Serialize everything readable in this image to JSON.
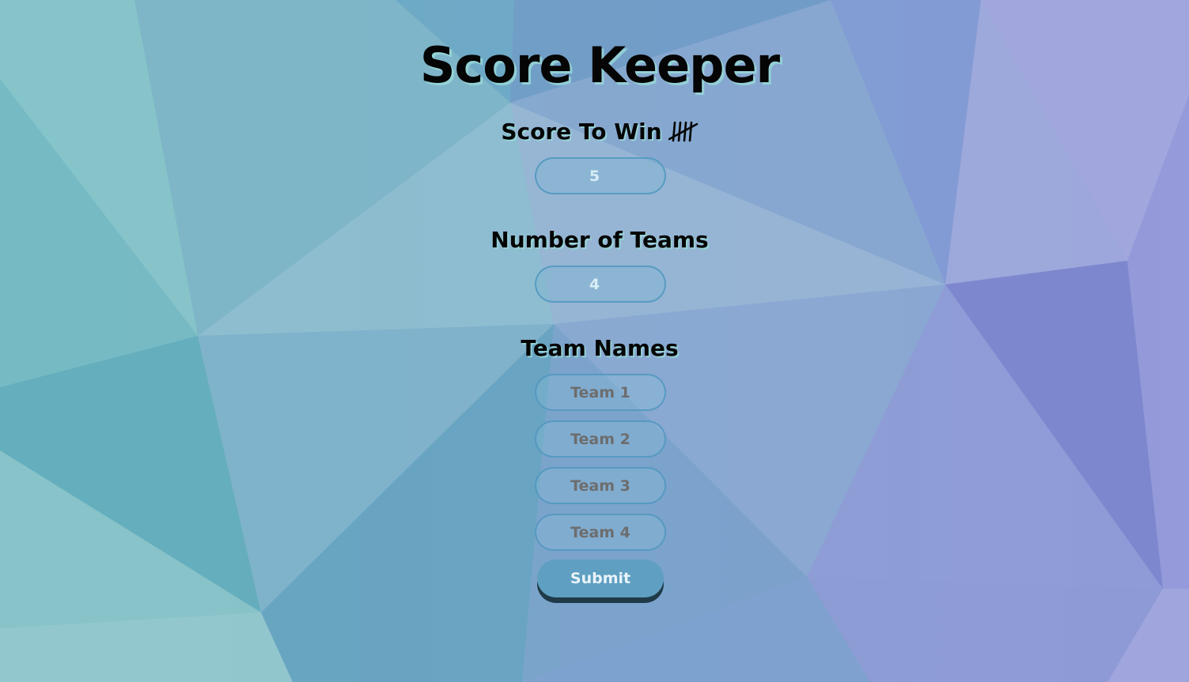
{
  "page": {
    "title": "Score Keeper"
  },
  "score_to_win": {
    "label": "Score To Win",
    "icon": "tally-marks-icon",
    "value_placeholder": "5"
  },
  "number_of_teams": {
    "label": "Number of Teams",
    "value_placeholder": "4"
  },
  "team_names": {
    "label": "Team Names",
    "fields": [
      {
        "placeholder": "Team 1"
      },
      {
        "placeholder": "Team 2"
      },
      {
        "placeholder": "Team 3"
      },
      {
        "placeholder": "Team 4"
      }
    ]
  },
  "submit": {
    "label": "Submit"
  },
  "colors": {
    "background_start": "#79c0c8",
    "background_end": "#8f9bd8",
    "submit_button": "#5f9fc1",
    "submit_shadow": "#1f3a48",
    "heading_text": "#050505"
  }
}
